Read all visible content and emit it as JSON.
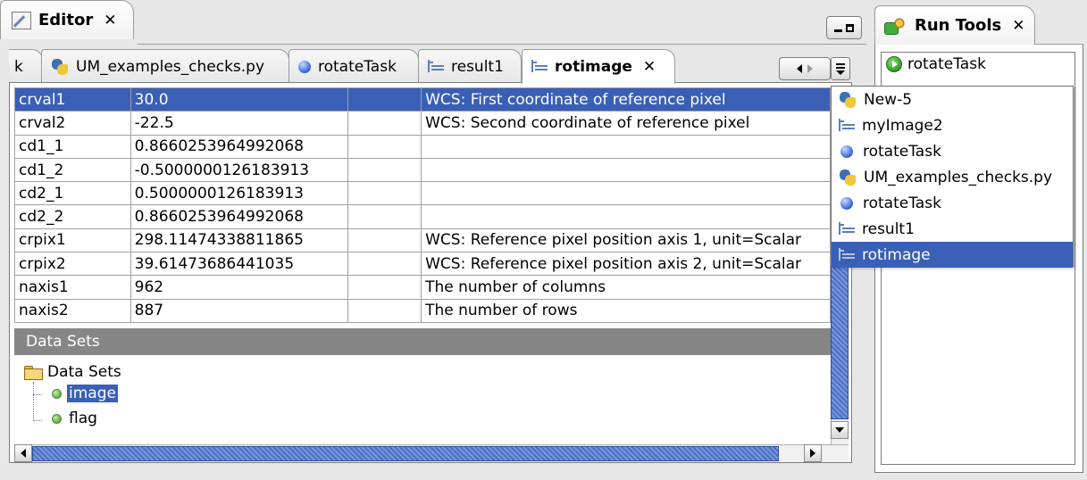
{
  "editor_view": {
    "title": "Editor",
    "close_glyph": "✕",
    "icon": "editor-icon"
  },
  "run_tools_view": {
    "title": "Run Tools",
    "close_glyph": "✕",
    "icon": "run-tools-icon",
    "items": [
      {
        "label": "rotateTask",
        "icon": "run-play-icon"
      }
    ]
  },
  "doc_tabs": [
    {
      "label": "k",
      "icon": "",
      "partial": true
    },
    {
      "label": "UM_examples_checks.py",
      "icon": "python-icon"
    },
    {
      "label": "rotateTask",
      "icon": "task-icon"
    },
    {
      "label": "result1",
      "icon": "dataset-icon"
    },
    {
      "label": "rotimage",
      "icon": "dataset-icon",
      "active": true,
      "close_glyph": "✕"
    }
  ],
  "table": {
    "selected_row": 0,
    "rows": [
      {
        "name": "crval1",
        "value": "30.0",
        "unit": "",
        "description": "WCS: First coordinate of reference pixel"
      },
      {
        "name": "crval2",
        "value": "-22.5",
        "unit": "",
        "description": "WCS: Second coordinate of reference pixel"
      },
      {
        "name": "cd1_1",
        "value": "0.8660253964992068",
        "unit": "",
        "description": ""
      },
      {
        "name": "cd1_2",
        "value": "-0.5000000126183913",
        "unit": "",
        "description": ""
      },
      {
        "name": "cd2_1",
        "value": "0.5000000126183913",
        "unit": "",
        "description": ""
      },
      {
        "name": "cd2_2",
        "value": "0.8660253964992068",
        "unit": "",
        "description": ""
      },
      {
        "name": "crpix1",
        "value": "298.11474338811865",
        "unit": "",
        "description": "WCS: Reference pixel position axis 1, unit=Scalar"
      },
      {
        "name": "crpix2",
        "value": "39.61473686441035",
        "unit": "",
        "description": "WCS: Reference pixel position axis 2, unit=Scalar"
      },
      {
        "name": "naxis1",
        "value": "962",
        "unit": "",
        "description": "The number of columns"
      },
      {
        "name": "naxis2",
        "value": "887",
        "unit": "",
        "description": "The number of rows"
      }
    ]
  },
  "datasets": {
    "header": "Data Sets",
    "root_label": "Data Sets",
    "children": [
      {
        "label": "image",
        "selected": true
      },
      {
        "label": "flag",
        "selected": false
      }
    ]
  },
  "doc_menu": {
    "items": [
      {
        "label": "New-5",
        "icon": "python-icon"
      },
      {
        "label": "myImage2",
        "icon": "dataset-icon"
      },
      {
        "label": "rotateTask",
        "icon": "task-icon"
      },
      {
        "label": "UM_examples_checks.py",
        "icon": "python-icon"
      },
      {
        "label": "rotateTask",
        "icon": "task-icon"
      },
      {
        "label": "result1",
        "icon": "dataset-icon"
      },
      {
        "label": "rotimage",
        "icon": "dataset-icon",
        "highlighted": true
      }
    ]
  },
  "colors": {
    "selection": "#3a5fb6",
    "section_header": "#868686",
    "window_bg": "#e7e7e7"
  }
}
